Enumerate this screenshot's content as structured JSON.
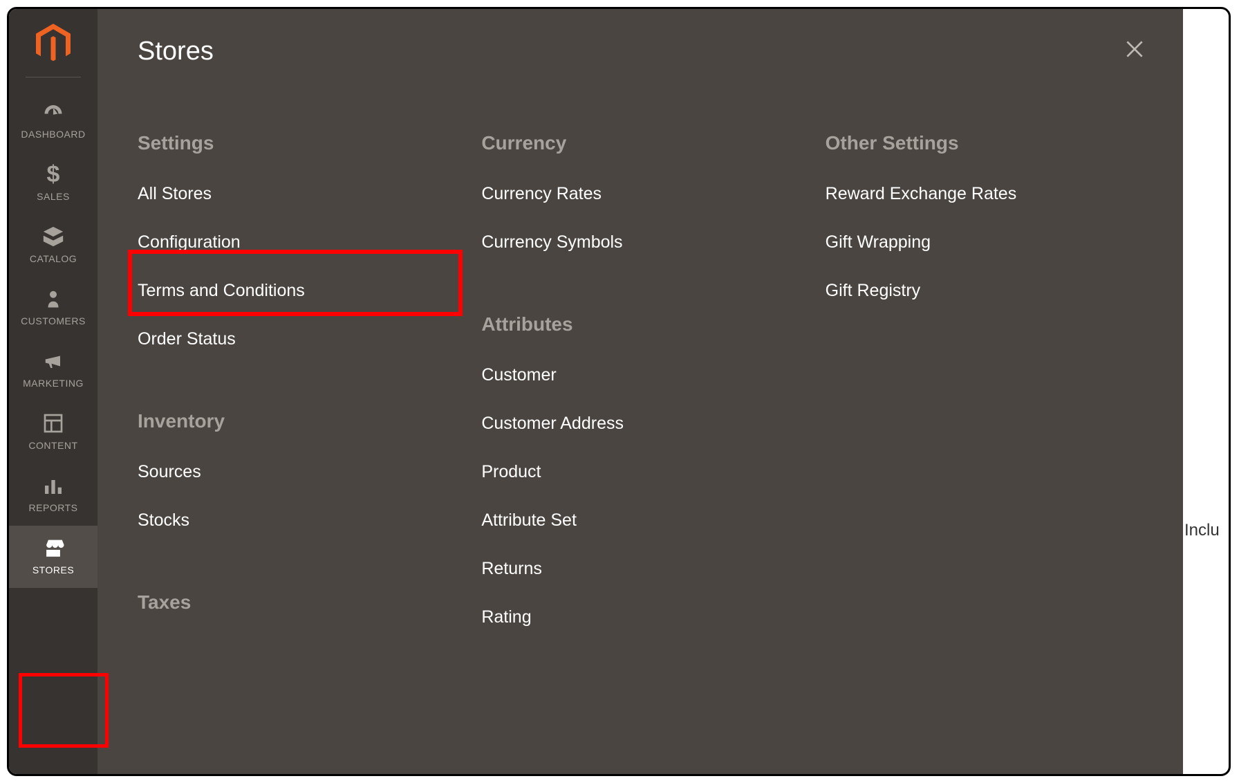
{
  "sidebar": {
    "items": [
      {
        "label": "DASHBOARD"
      },
      {
        "label": "SALES"
      },
      {
        "label": "CATALOG"
      },
      {
        "label": "CUSTOMERS"
      },
      {
        "label": "MARKETING"
      },
      {
        "label": "CONTENT"
      },
      {
        "label": "REPORTS"
      },
      {
        "label": "STORES"
      }
    ]
  },
  "flyout": {
    "title": "Stores",
    "columns": {
      "col1": {
        "group1_heading": "Settings",
        "group1_items": [
          "All Stores",
          "Configuration",
          "Terms and Conditions",
          "Order Status"
        ],
        "group2_heading": "Inventory",
        "group2_items": [
          "Sources",
          "Stocks"
        ],
        "group3_heading": "Taxes"
      },
      "col2": {
        "group1_heading": "Currency",
        "group1_items": [
          "Currency Rates",
          "Currency Symbols"
        ],
        "group2_heading": "Attributes",
        "group2_items": [
          "Customer",
          "Customer Address",
          "Product",
          "Attribute Set",
          "Returns",
          "Rating"
        ]
      },
      "col3": {
        "group1_heading": "Other Settings",
        "group1_items": [
          "Reward Exchange Rates",
          "Gift Wrapping",
          "Gift Registry"
        ]
      }
    }
  },
  "background": {
    "partial_text": "Inclu"
  }
}
